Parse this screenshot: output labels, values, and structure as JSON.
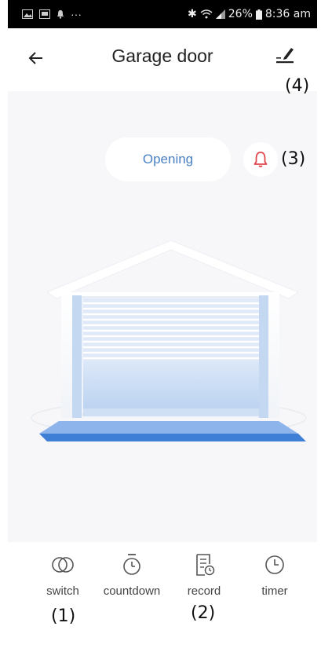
{
  "status_bar": {
    "battery": "26%",
    "time": "8:36 am",
    "notification_dots": "···"
  },
  "header": {
    "title": "Garage door",
    "back_icon": "arrow-left-icon",
    "edit_icon": "pencil-edit-icon"
  },
  "door": {
    "status": "Opening",
    "alarm_icon": "bell-icon",
    "accent_color": "#4a82c5",
    "bell_color": "#e0454d"
  },
  "actions": [
    {
      "label": "switch",
      "icon": "switch-toggle-icon"
    },
    {
      "label": "countdown",
      "icon": "stopwatch-icon"
    },
    {
      "label": "record",
      "icon": "record-list-icon"
    },
    {
      "label": "timer",
      "icon": "clock-icon"
    }
  ],
  "annotations": {
    "a1": "(1)",
    "a2": "(2)",
    "a3": "(3)",
    "a4": "(4)"
  }
}
